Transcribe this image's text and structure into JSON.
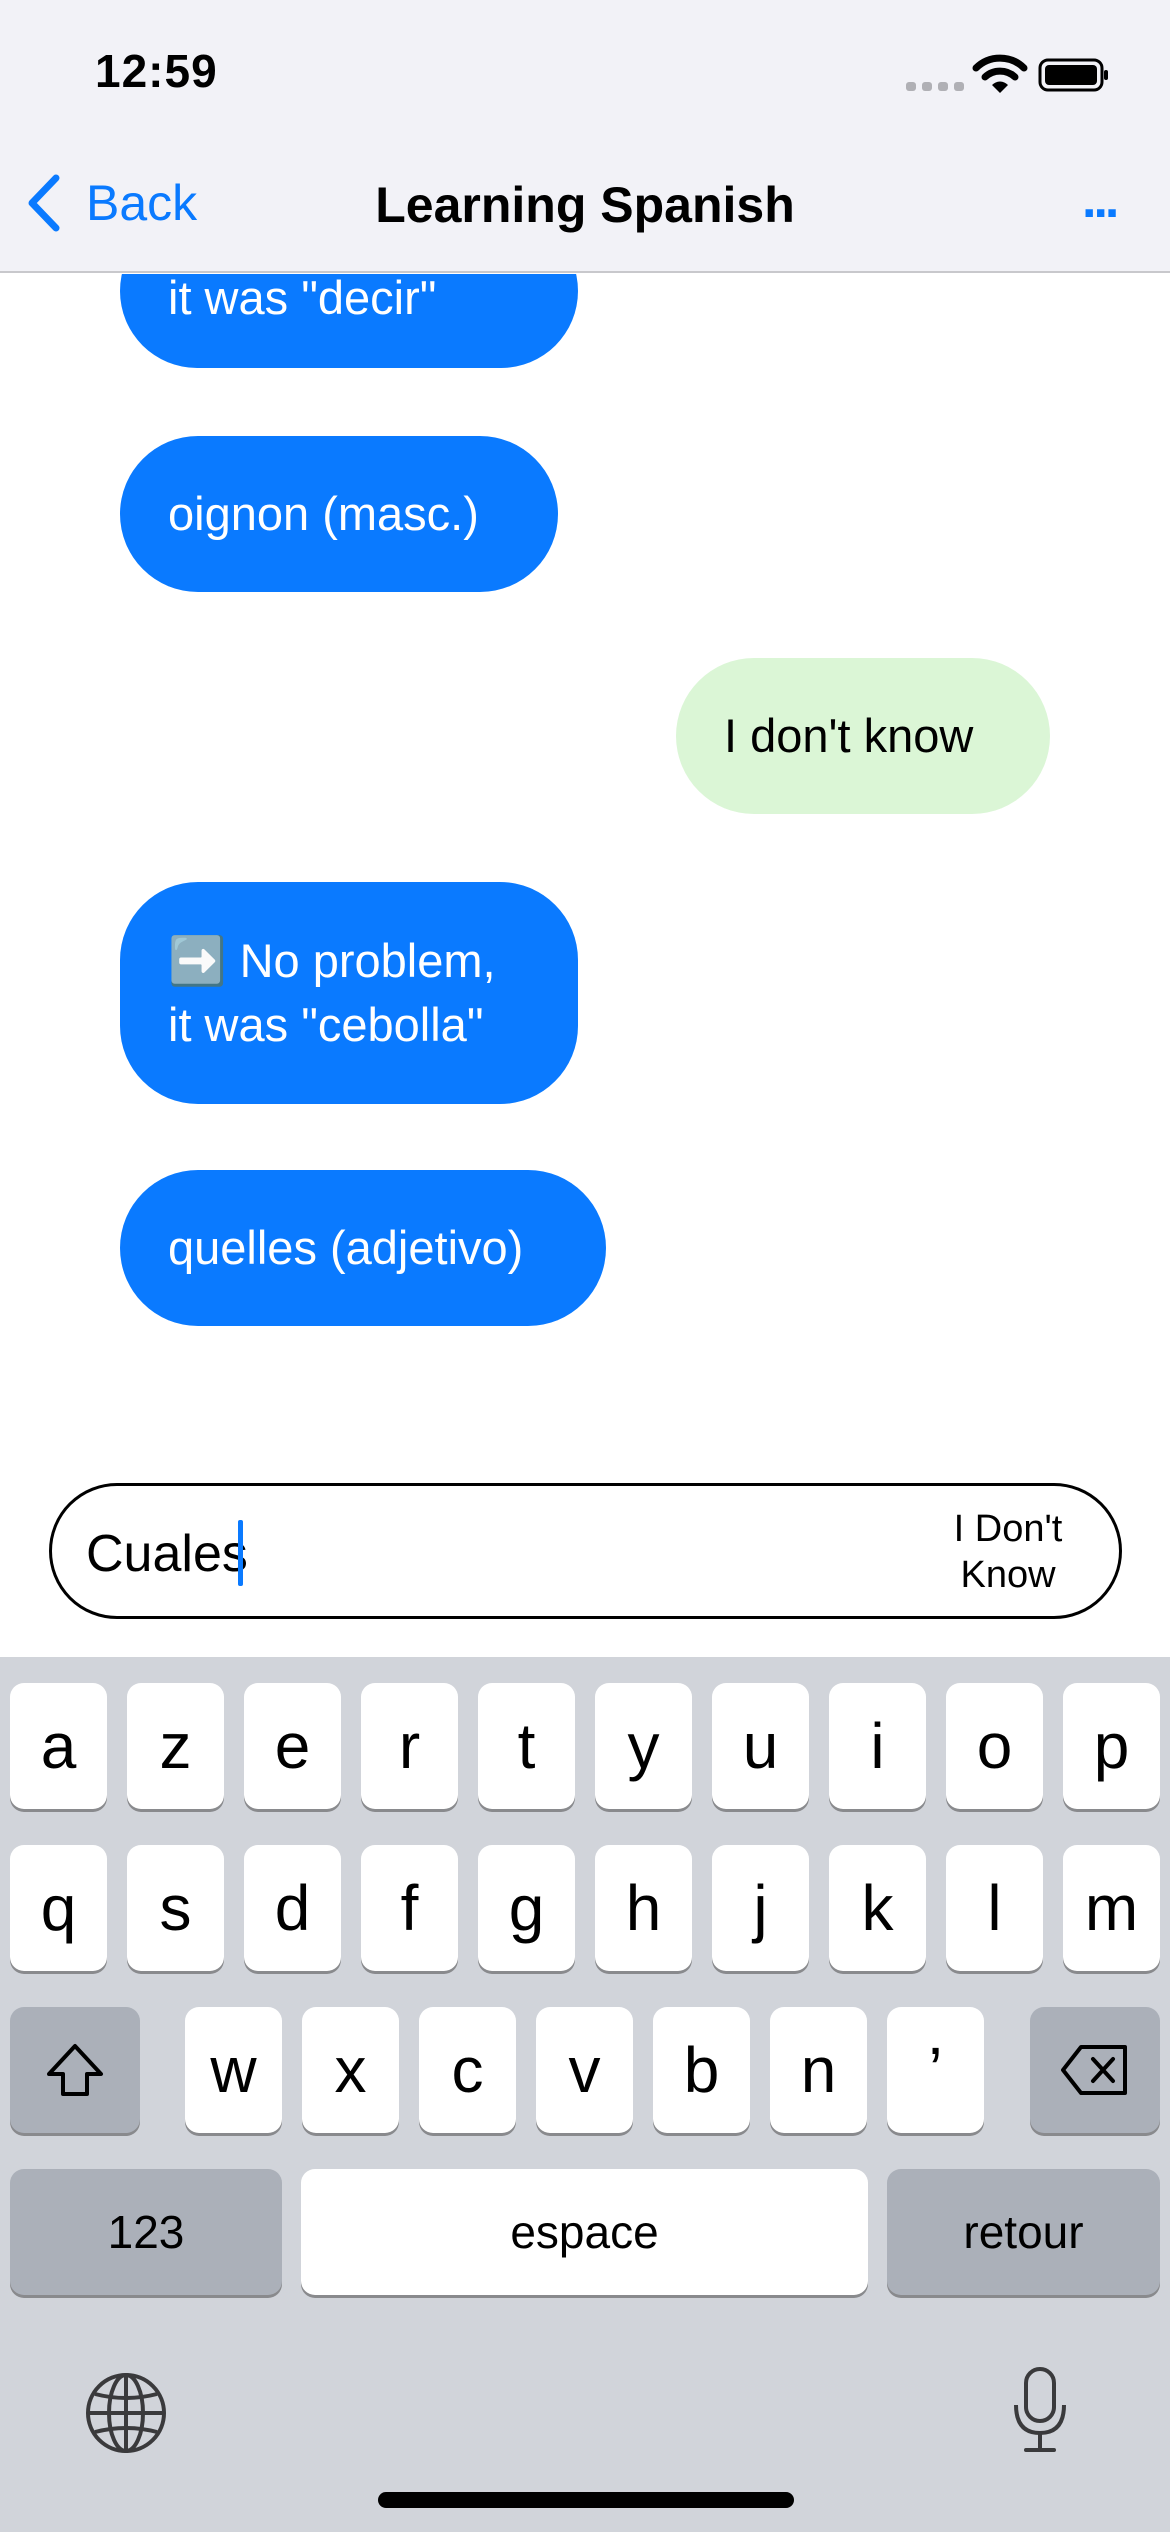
{
  "status": {
    "time": "12:59"
  },
  "nav": {
    "back_label": "Back",
    "title": "Learning Spanish",
    "more_label": "..."
  },
  "messages": [
    {
      "from": "bot",
      "text": "it was \"decir\""
    },
    {
      "from": "bot",
      "text": "oignon (masc.)"
    },
    {
      "from": "user",
      "text": "I don't know"
    },
    {
      "from": "bot",
      "line1": "➡️ No problem,",
      "line2": "it was \"cebolla\""
    },
    {
      "from": "bot",
      "text": "quelles (adjetivo)"
    }
  ],
  "composer": {
    "value": "Cuales",
    "idk_line1": "I Don't",
    "idk_line2": "Know"
  },
  "keyboard": {
    "row1": [
      "a",
      "z",
      "e",
      "r",
      "t",
      "y",
      "u",
      "i",
      "o",
      "p"
    ],
    "row2": [
      "q",
      "s",
      "d",
      "f",
      "g",
      "h",
      "j",
      "k",
      "l",
      "m"
    ],
    "row3": [
      "w",
      "x",
      "c",
      "v",
      "b",
      "n",
      "’"
    ],
    "numbers_label": "123",
    "space_label": "espace",
    "return_label": "retour"
  },
  "colors": {
    "accent": "#0a7aff",
    "bot_bubble": "#0a7aff",
    "user_bubble": "#dbf6d6",
    "keyboard_bg": "#d1d4da"
  },
  "icons": [
    "signal-icon",
    "wifi-icon",
    "battery-icon",
    "chevron-left-icon",
    "shift-icon",
    "delete-icon",
    "globe-icon",
    "microphone-icon"
  ]
}
